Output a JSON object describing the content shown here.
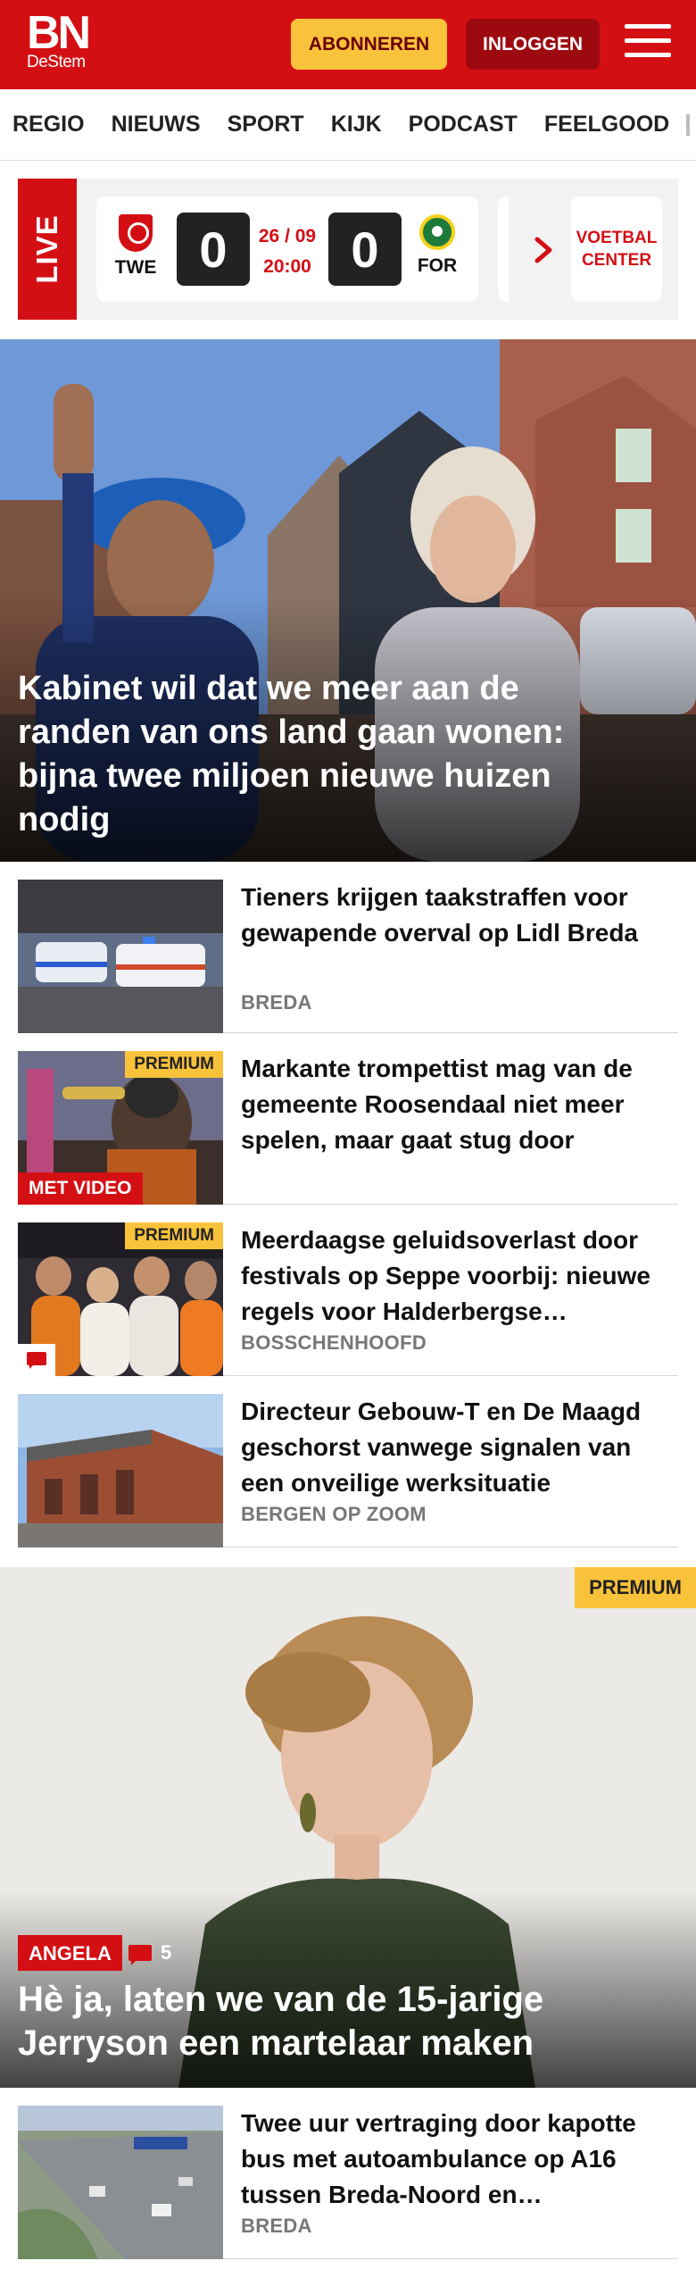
{
  "header": {
    "logo_main": "BN",
    "logo_sub": "DeStem",
    "subscribe_label": "ABONNEREN",
    "login_label": "INLOGGEN",
    "menu_icon": "hamburger-menu-icon"
  },
  "nav": {
    "items": [
      "REGIO",
      "NIEUWS",
      "SPORT",
      "KIJK",
      "PODCAST",
      "FEELGOOD"
    ]
  },
  "live": {
    "label": "LIVE",
    "home_team": "TWE",
    "home_score": "0",
    "date": "26 / 09",
    "time": "20:00",
    "away_score": "0",
    "away_team": "FOR",
    "center_label_line1": "VOETBAL",
    "center_label_line2": "CENTER",
    "accent": "#d40f14"
  },
  "hero": {
    "title": "Kabinet wil dat we meer aan de randen van ons land gaan wonen: bijna twee miljoen nieuwe huizen nodig"
  },
  "articles": [
    {
      "title": "Tieners krijgen taakstraffen voor gewapende overval op Lidl Breda",
      "category": "BREDA"
    },
    {
      "title": "Markante trompettist mag van de gemeente Roosendaal niet meer spelen, maar gaat stug door",
      "premium": "PREMIUM",
      "video": "MET VIDEO",
      "category": ""
    },
    {
      "title": "Meerdaagse geluidsoverlast door festivals op Seppe voorbij: nieuwe regels voor Halderbergse evenementen",
      "premium": "PREMIUM",
      "category": "BOSSCHENHOOFD"
    },
    {
      "title": "Directeur Gebouw-T en De Maagd geschorst vanwege signalen van een onveilige werksituatie",
      "category": "BERGEN OP ZOOM"
    }
  ],
  "feature": {
    "premium": "PREMIUM",
    "columnist": "ANGELA",
    "comment_count": "5",
    "title": "Hè ja, laten we van de 15-jarige Jerryson een martelaar maken"
  },
  "articles_after": [
    {
      "title": "Twee uur vertraging door kapotte bus met autoambulance op A16 tussen Breda-Noord en Zevenbergschen Hoek",
      "category": "BREDA"
    }
  ],
  "colors": {
    "brand_red": "#d40f14",
    "premium_yellow": "#f8c23a"
  }
}
